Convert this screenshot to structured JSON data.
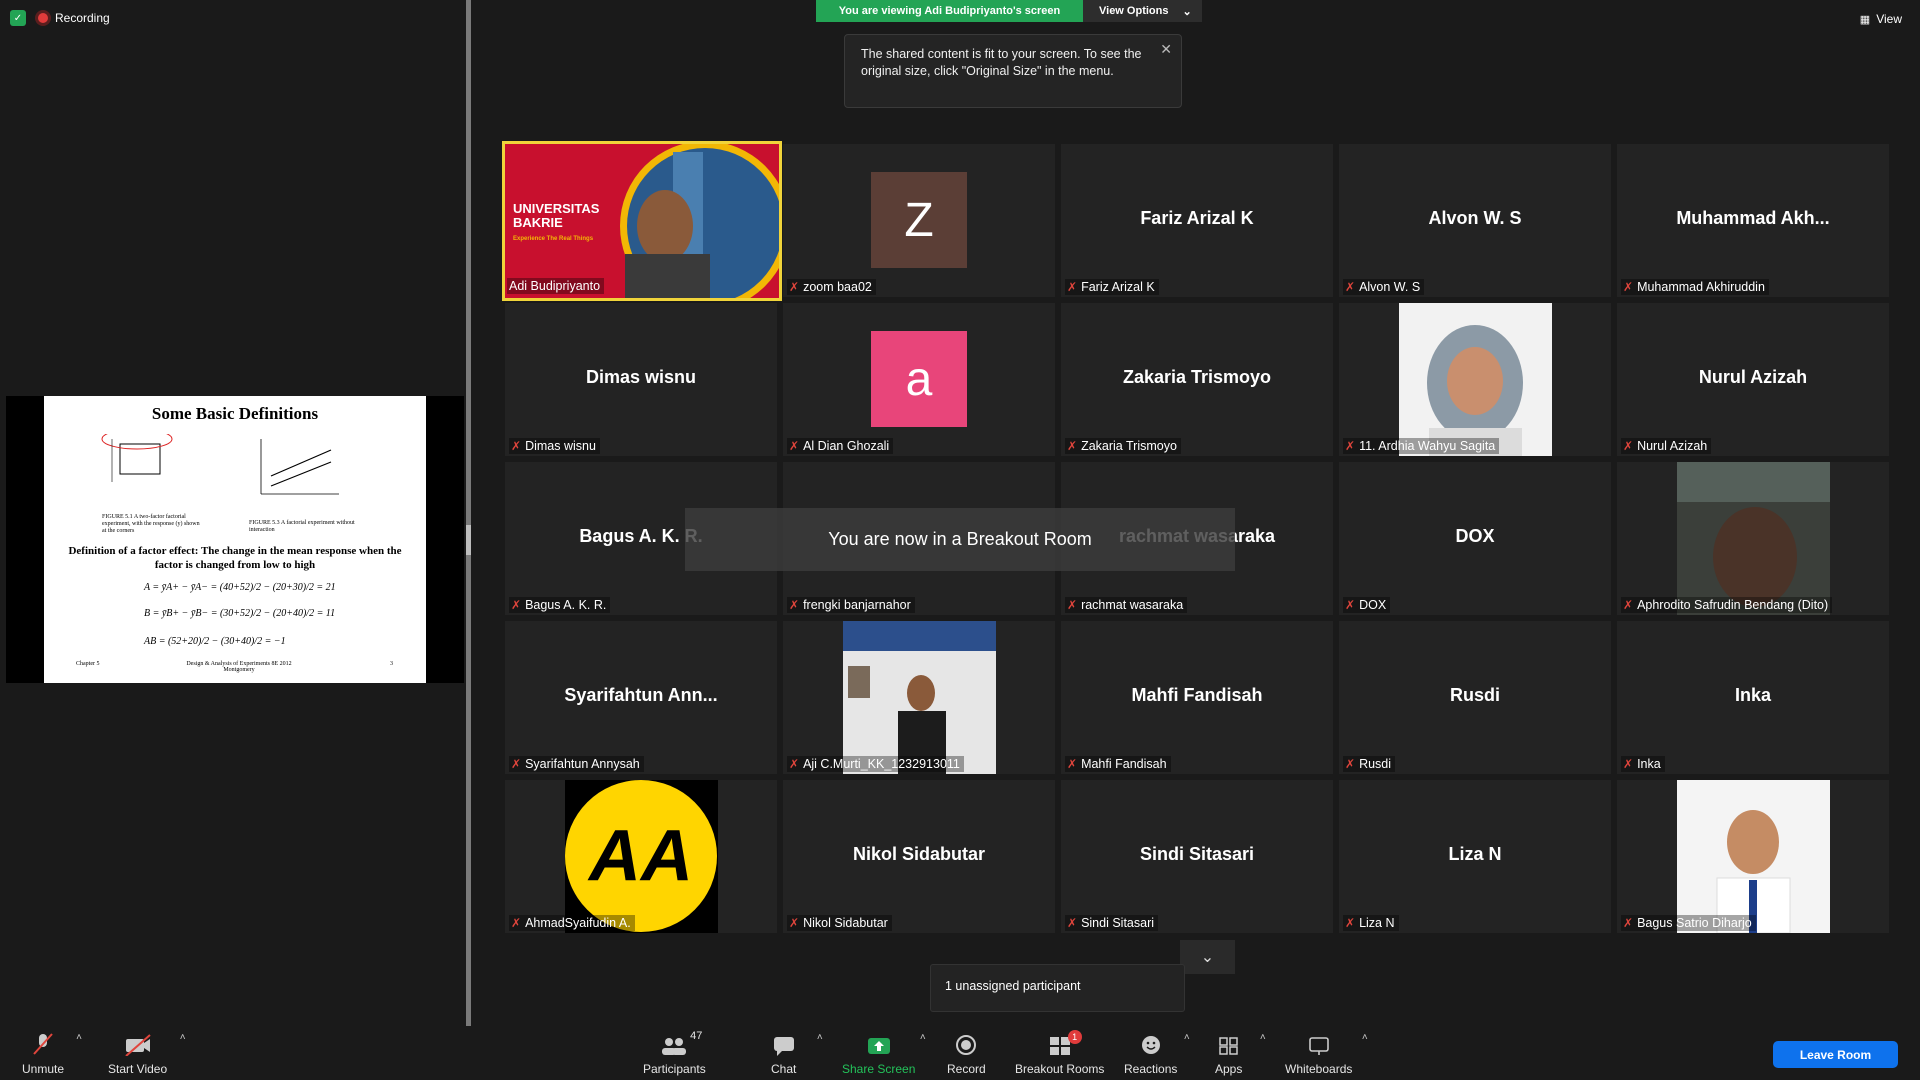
{
  "recording": {
    "label": "Recording"
  },
  "banner": {
    "viewing": "You are viewing Adi Budipriyanto's screen",
    "view_options": "View Options"
  },
  "tooltip": {
    "text": "The shared content is fit to your screen. To see the original size, click \"Original Size\" in the menu."
  },
  "view_button": {
    "label": "View"
  },
  "slide": {
    "title": "Some Basic Definitions",
    "fig1_caption": "FIGURE 5.1 A two-factor factorial experiment, with the response (y) shown at the corners",
    "fig2_caption": "FIGURE 5.3 A factorial experiment without interaction",
    "definition": "Definition of a factor effect: The change in the mean response when the factor is changed from low to high",
    "eq_a": "A = ȳA+ − ȳA− = (40+52)/2 − (20+30)/2 = 21",
    "eq_b": "B = ȳB+ − ȳB− = (30+52)/2 − (20+40)/2 = 11",
    "eq_ab": "AB = (52+20)/2 − (30+40)/2 = −1",
    "footer_left": "Chapter 5",
    "footer_center": "Design & Analysis of Experiments 8E 2012 Montgomery",
    "footer_right": "3"
  },
  "speaker": {
    "label": "Adi Budipriyanto",
    "brand": "UNIVERSITAS BAKRIE",
    "tagline": "Experience The Real Things"
  },
  "participants": [
    {
      "display": "",
      "label": "zoom baa02",
      "letter": "Z",
      "color": "#5b3e36"
    },
    {
      "display": "Fariz Arizal K",
      "label": "Fariz Arizal K"
    },
    {
      "display": "Alvon W. S",
      "label": "Alvon W. S"
    },
    {
      "display": "Muhammad  Akh...",
      "label": "Muhammad Akhiruddin"
    },
    {
      "display": "Dimas wisnu",
      "label": "Dimas wisnu"
    },
    {
      "display": "",
      "label": "Al Dian Ghozali",
      "letter": "a",
      "color": "#e8457a"
    },
    {
      "display": "Zakaria Trismoyo",
      "label": "Zakaria Trismoyo"
    },
    {
      "display": "",
      "label": "11. Ardhia Wahyu Sagita",
      "photo": "hijab"
    },
    {
      "display": "Nurul Azizah",
      "label": "Nurul Azizah"
    },
    {
      "display": "Bagus A. K. R.",
      "label": "Bagus A. K. R."
    },
    {
      "display": "",
      "label": "frengki banjarnahor"
    },
    {
      "display": "rachmat wasaraka",
      "label": "rachmat wasaraka"
    },
    {
      "display": "DOX",
      "label": "DOX"
    },
    {
      "display": "",
      "label": "Aphrodito Safrudin Bendang (Dito)",
      "photo": "dark"
    },
    {
      "display": "Syarifahtun  Ann...",
      "label": "Syarifahtun Annysah"
    },
    {
      "display": "",
      "label": "Aji C.Murti_KK_1232913011",
      "photo": "room"
    },
    {
      "display": "Mahfi Fandisah",
      "label": "Mahfi Fandisah"
    },
    {
      "display": "Rusdi",
      "label": "Rusdi"
    },
    {
      "display": "Inka",
      "label": "Inka"
    },
    {
      "display": "",
      "label": "AhmadSyaifudin A.",
      "photo": "aa"
    },
    {
      "display": "Nikol Sidabutar",
      "label": "Nikol Sidabutar"
    },
    {
      "display": "Sindi Sitasari",
      "label": "Sindi Sitasari"
    },
    {
      "display": "Liza N",
      "label": "Liza N"
    },
    {
      "display": "",
      "label": "Bagus Satrio Diharjo",
      "photo": "man"
    }
  ],
  "toast": {
    "text": "You are now in a Breakout Room"
  },
  "unassigned": {
    "text": "1 unassigned participant"
  },
  "toolbar": {
    "unmute": "Unmute",
    "start_video": "Start Video",
    "participants": "Participants",
    "participants_count": "47",
    "chat": "Chat",
    "share_screen": "Share Screen",
    "record": "Record",
    "breakout_rooms": "Breakout Rooms",
    "breakout_badge": "1",
    "reactions": "Reactions",
    "apps": "Apps",
    "whiteboards": "Whiteboards",
    "leave": "Leave Room"
  },
  "colors": {
    "accent_green": "#23a455",
    "speaker_border": "#f0d43a",
    "leave_blue": "#0e72ed",
    "mic_off": "#e0453c"
  }
}
